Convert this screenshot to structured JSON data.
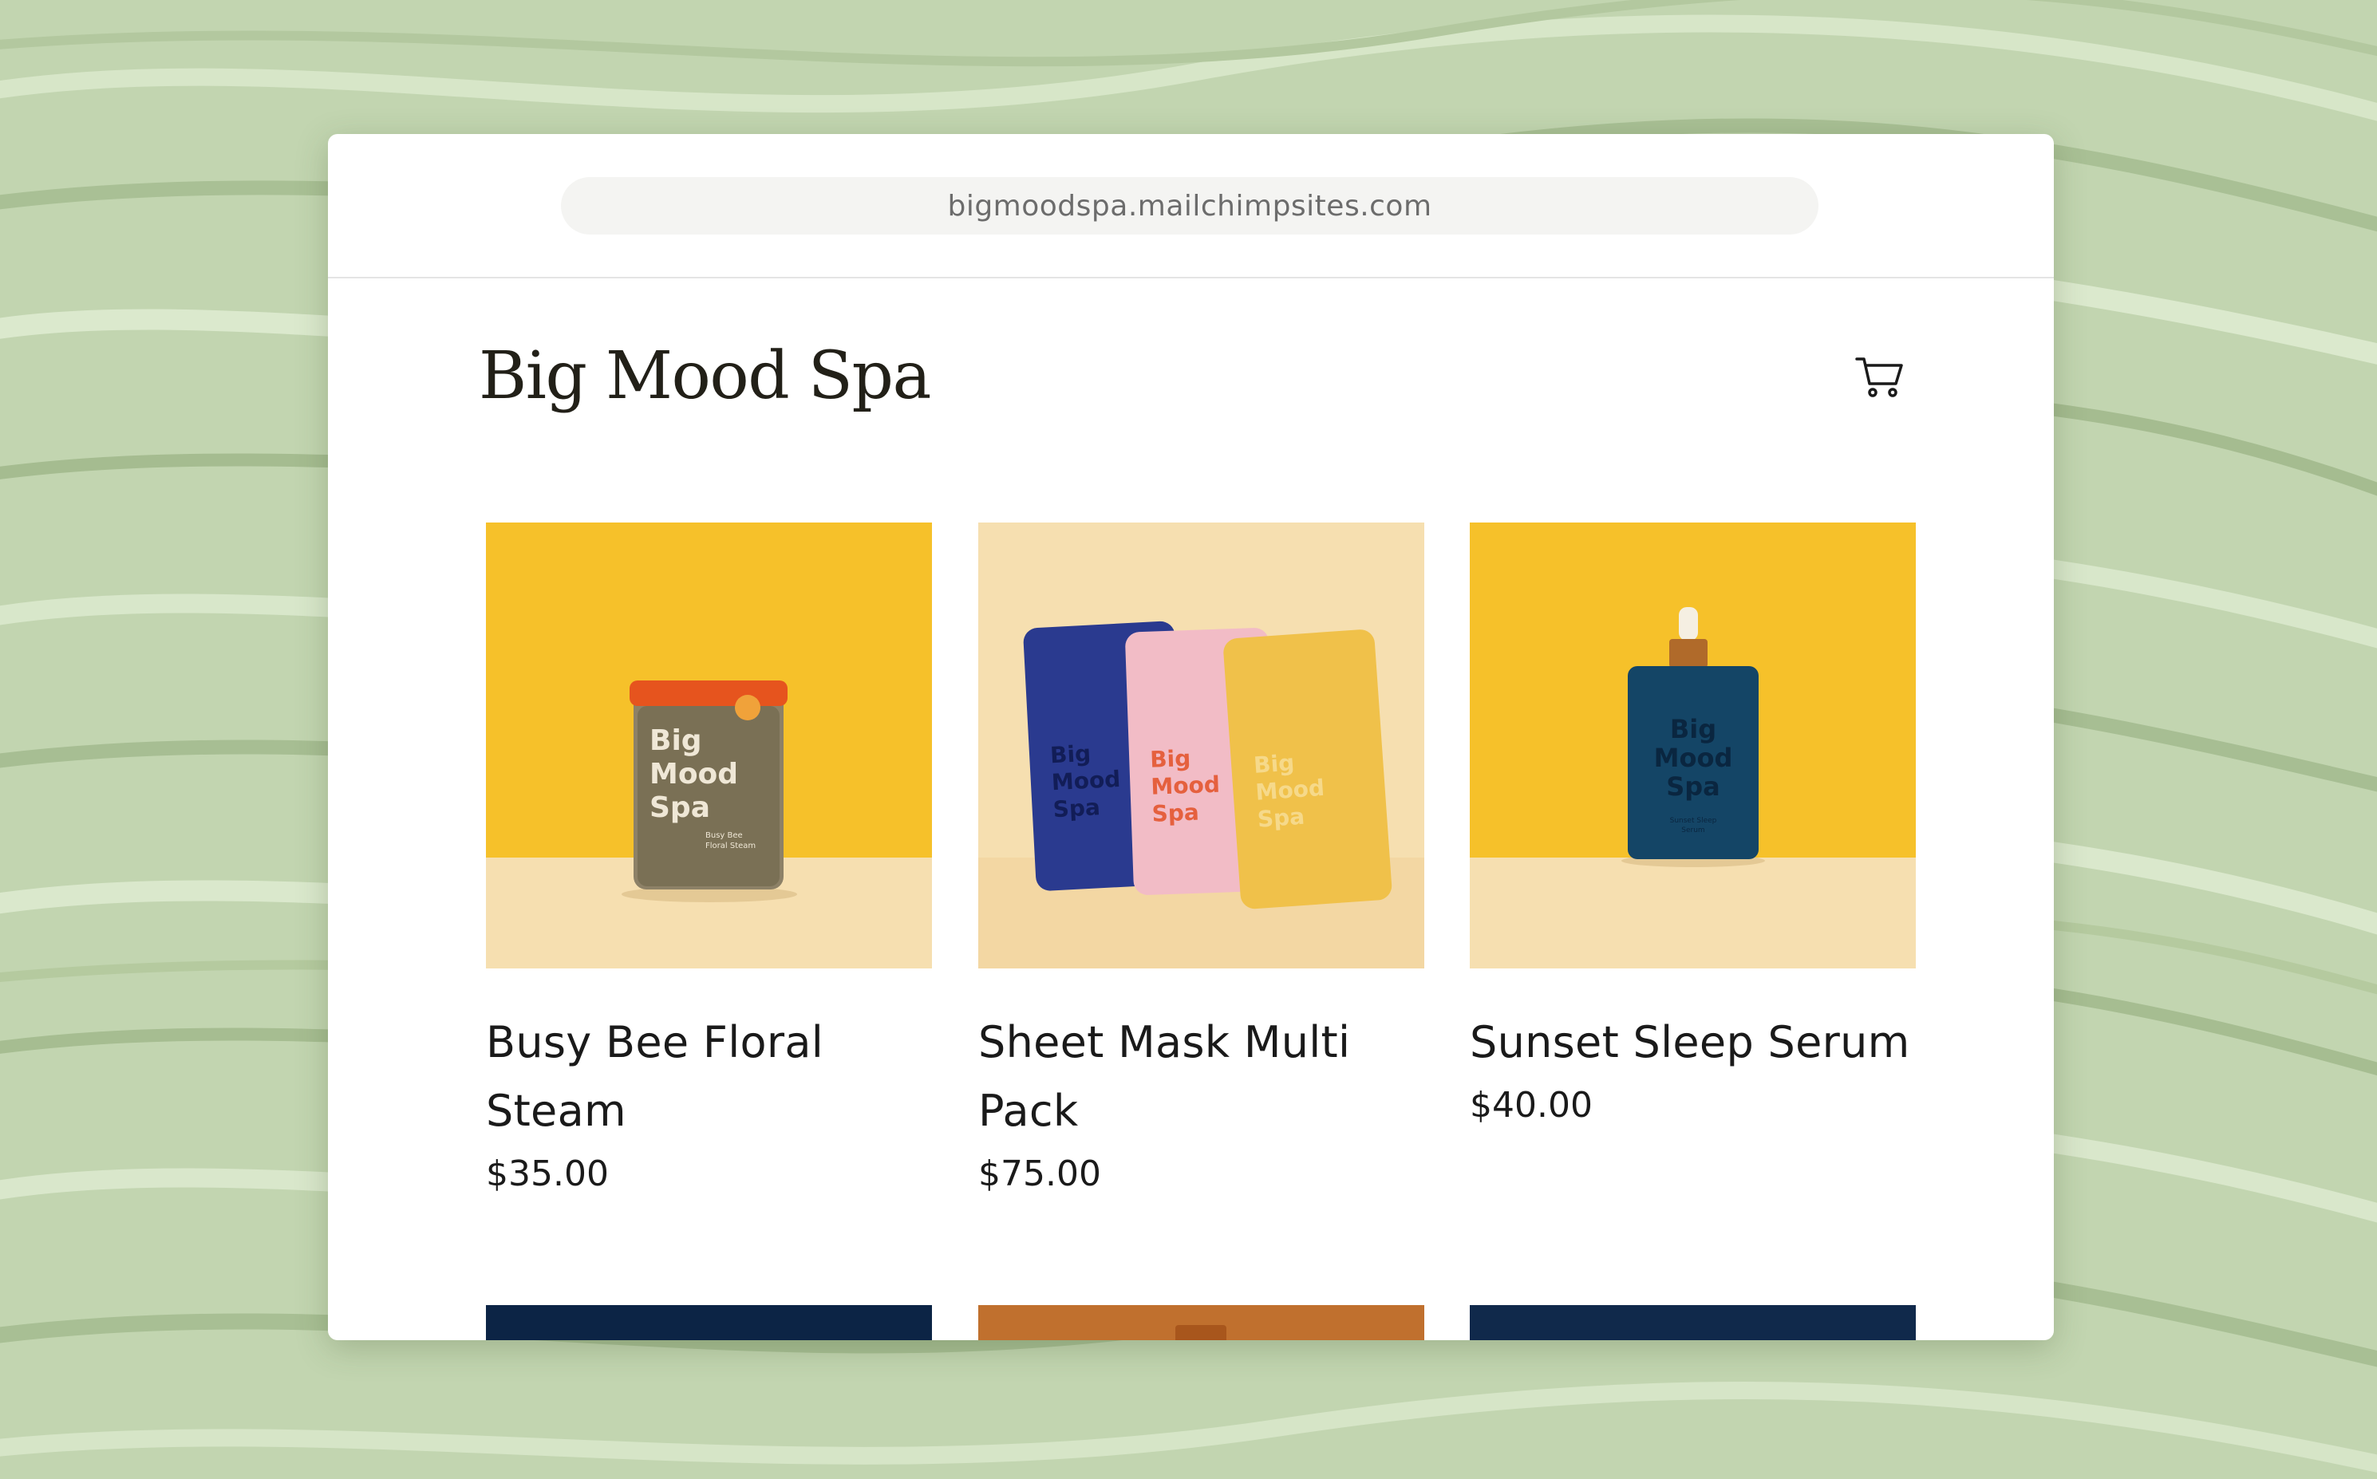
{
  "browser": {
    "url": "bigmoodspa.mailchimpsites.com"
  },
  "site": {
    "title": "Big Mood Spa"
  },
  "products": [
    {
      "name": "Busy Bee Floral Steam",
      "price": "$35.00",
      "label": [
        "Big",
        "Mood",
        "Spa"
      ],
      "small_label": [
        "Busy Bee",
        "Floral Steam"
      ]
    },
    {
      "name": "Sheet Mask Multi Pack",
      "price": "$75.00",
      "label": [
        "Big",
        "Mood",
        "Spa"
      ]
    },
    {
      "name": "Sunset Sleep Serum",
      "price": "$40.00",
      "label": [
        "Big",
        "Mood",
        "Spa"
      ],
      "small_label": [
        "Sunset Sleep",
        "Serum"
      ]
    }
  ],
  "colors": {
    "background": "#c2d5b0",
    "photo_wall_yellow": "#f6c12a",
    "photo_floor_cream": "#f6dfb0",
    "jar_lid": "#e6541e",
    "pouch_blue": "#2a3a8f",
    "pouch_pink": "#f2bcc6",
    "pouch_yellow": "#f0c14a",
    "serum_bottle": "#144566",
    "dropper_cap": "#b06a2a"
  },
  "icons": {
    "cart": "cart-icon"
  }
}
